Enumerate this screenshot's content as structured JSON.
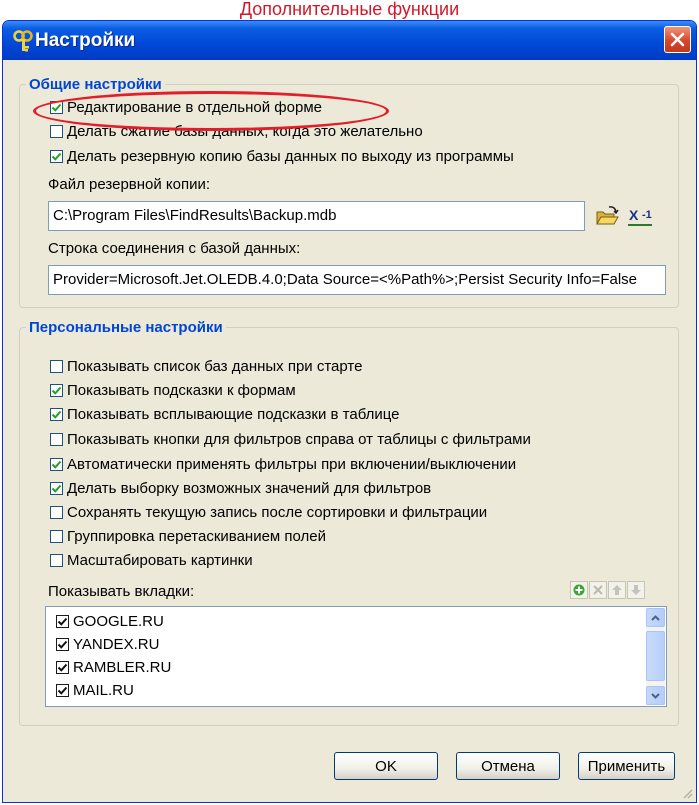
{
  "caption": "Дополнительные функции",
  "window": {
    "title": "Настройки"
  },
  "general": {
    "legend": "Общие настройки",
    "options": [
      {
        "label": "Редактирование в отдельной форме",
        "checked": true
      },
      {
        "label": "Делать сжатие базы данных, когда это желательно",
        "checked": false
      },
      {
        "label": "Делать резервную копию базы данных по выходу из программы",
        "checked": true
      }
    ],
    "backup_label": "Файл резервной копии:",
    "backup_value": "C:\\Program Files\\FindResults\\Backup.mdb",
    "conn_label": "Строка соединения с базой данных:",
    "conn_value": "Provider=Microsoft.Jet.OLEDB.4.0;Data Source=<%Path%>;Persist Security Info=False"
  },
  "personal": {
    "legend": "Персональные настройки",
    "options": [
      {
        "label": "Показывать список баз данных при старте",
        "checked": false
      },
      {
        "label": "Показывать подсказки к формам",
        "checked": true
      },
      {
        "label": "Показывать всплывающие подсказки в таблице",
        "checked": true
      },
      {
        "label": "Показывать кнопки для фильтров справа от таблицы с фильтрами",
        "checked": false
      },
      {
        "label": "Автоматически применять фильтры при включении/выключении",
        "checked": true
      },
      {
        "label": "Делать выборку возможных значений для фильтров",
        "checked": true
      },
      {
        "label": "Сохранять текущую запись после сортировки и фильтрации",
        "checked": false
      },
      {
        "label": "Группировка перетаскиванием полей",
        "checked": false
      },
      {
        "label": "Масштабировать картинки",
        "checked": false
      }
    ],
    "tabs_label": "Показывать вкладки:",
    "tabs": [
      {
        "label": "GOOGLE.RU",
        "checked": true
      },
      {
        "label": "YANDEX.RU",
        "checked": true
      },
      {
        "label": "RAMBLER.RU",
        "checked": true
      },
      {
        "label": "MAIL.RU",
        "checked": true
      }
    ]
  },
  "buttons": {
    "ok": "OK",
    "cancel": "Отмена",
    "apply": "Применить"
  },
  "icons": {
    "window": "key-icon",
    "close": "close-icon",
    "browse": "open-folder-icon",
    "excel": "excel-icon",
    "add": "add-icon",
    "delete": "delete-icon",
    "up": "arrow-up-icon",
    "down": "arrow-down-icon"
  },
  "colors": {
    "title_bar": "#0054e3",
    "legend": "#0046d5",
    "face": "#ece9d8",
    "highlight": "#e31e2b",
    "caption": "#d0182b"
  }
}
